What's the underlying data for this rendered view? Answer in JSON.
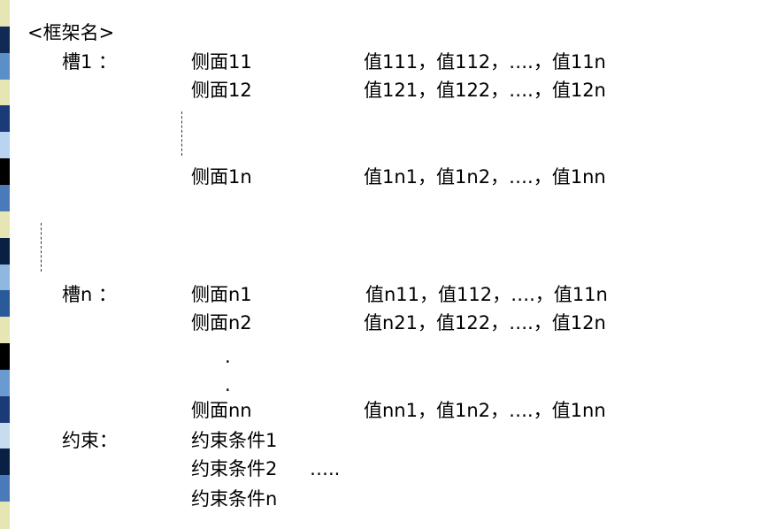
{
  "frame_title": "<框架名>",
  "slots": [
    {
      "label": "槽1 ：",
      "facets": [
        {
          "name": "侧面11",
          "values": "值111，值112，….，值11n"
        },
        {
          "name": "侧面12",
          "values": "值121，值122，….，值12n"
        },
        {
          "name": "侧面1n",
          "values": "值1n1，值1n2，….，值1nn"
        }
      ]
    },
    {
      "label": "槽n ：",
      "facets": [
        {
          "name": "侧面n1",
          "values": "值n11，值112，….，值11n"
        },
        {
          "name": "侧面n2",
          "values": "值n21，值122，….，值12n"
        },
        {
          "name": "侧面nn",
          "values": "值nn1，值1n2，….，值1nn"
        }
      ]
    }
  ],
  "constraints": {
    "label": "约束：",
    "items": [
      "约束条件1",
      "约束条件2",
      "约束条件n"
    ],
    "continuation": "…..",
    "ellipsis_dot": "."
  },
  "colors": {
    "stripe": [
      "#e6e6b4",
      "#102a55",
      "#5a8fc8",
      "#e6e6b4",
      "#1a3a78",
      "#b8d4f0",
      "#000000",
      "#4a7ab8",
      "#e6e6b4",
      "#0a1f44",
      "#8fb8e0",
      "#2a5a98",
      "#e6e6b4",
      "#000000",
      "#6a9ad0",
      "#1a3a78",
      "#c8dcf0",
      "#0a1f44",
      "#4a7ab8",
      "#e6e6b4"
    ]
  }
}
